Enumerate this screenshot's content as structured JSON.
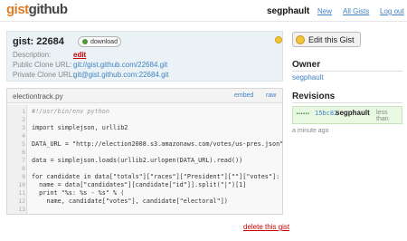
{
  "header": {
    "logo_part1": "gist",
    "logo_part2": "github",
    "username": "segphault",
    "nav": [
      "New",
      "All Gists",
      "Log out"
    ]
  },
  "gist": {
    "title": "gist: 22684",
    "download_label": "download",
    "description_label": "Description:",
    "description_value": "edit",
    "public_label": "Public Clone URL:",
    "public_url": "git://gist.github.com/22684.git",
    "private_label": "Private Clone URL:",
    "private_url": "git@gist.github.com:22684.git"
  },
  "file": {
    "name": "electiontrack.py",
    "embed_label": "embed",
    "raw_label": "raw",
    "line_numbers": [
      "1",
      "2",
      "3",
      "4",
      "5",
      "6",
      "7",
      "8",
      "9",
      "10",
      "11",
      "12",
      "13"
    ],
    "lines": [
      "#!/usr/bin/env python",
      "",
      "import simplejson, urllib2",
      "",
      "DATA_URL = \"http://election2008.s3.amazonaws.com/votes/us-pres.json\"",
      "",
      "data = simplejson.loads(urllib2.urlopen(DATA_URL).read())",
      "",
      "for candidate in data[\"totals\"][\"races\"][\"President\"][\"\"][\"votes\"]:",
      "  name = data[\"candidates\"][candidate[\"id\"]].split(\"|\")[1]",
      "  print \"%s: %s - %s\" % (",
      "    name, candidate[\"votes\"], candidate[\"electoral\"])",
      ""
    ]
  },
  "delete_label": "delete this gist",
  "sidebar": {
    "edit_button": "Edit this Gist",
    "owner_heading": "Owner",
    "owner_name": "segphault",
    "revisions_heading": "Revisions",
    "revision": {
      "dots": "••••••",
      "sha": "15bc82",
      "user": "segphault",
      "time_line1": "less than",
      "time_line2": "a minute ago"
    }
  },
  "colors": {
    "link": "#4183c4",
    "danger": "#cc0000",
    "logo_accent": "#e07d26",
    "meta_bg": "#eaf2f5",
    "revision_bg": "#e9f8e3"
  }
}
